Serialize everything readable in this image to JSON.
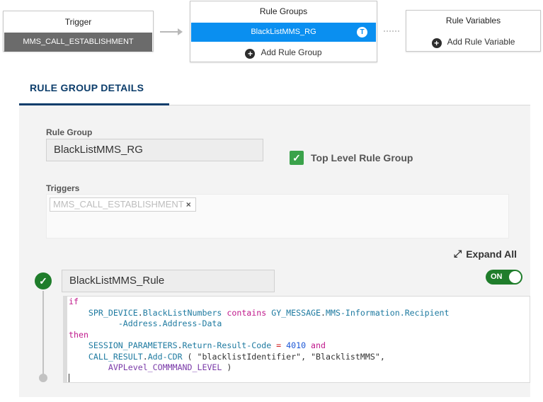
{
  "flow": {
    "trigger": {
      "title": "Trigger",
      "item": "MMS_CALL_ESTABLISHMENT"
    },
    "rule_groups": {
      "title": "Rule Groups",
      "selected": "BlackListMMS_RG",
      "badge": "T",
      "add_label": "Add Rule Group"
    },
    "rule_variables": {
      "title": "Rule Variables",
      "add_label": "Add Rule Variable"
    }
  },
  "section": {
    "tab_label": "RULE GROUP DETAILS"
  },
  "details": {
    "rule_group_label": "Rule Group",
    "rule_group_value": "BlackListMMS_RG",
    "top_level_label": "Top Level Rule Group",
    "top_level_checked": true,
    "triggers_label": "Triggers",
    "trigger_chip": "MMS_CALL_ESTABLISHMENT",
    "chip_remove": "×",
    "expand_all": "Expand All"
  },
  "rule": {
    "name": "BlackListMMS_Rule",
    "toggle_label": "ON",
    "code": {
      "l1_if": "if",
      "l2_obj": "SPR_DEVICE",
      "l2_dot": ".",
      "l2_field": "BlackListNumbers",
      "l2_kw": "contains",
      "l2_obj2": "GY_MESSAGE",
      "l2_dot2": ".",
      "l2_field2": "MMS-Information.Recipient",
      "l3_field": "-Address.Address-Data",
      "l4_then": "then",
      "l5_obj": "SESSION_PARAMETERS",
      "l5_dot": ".",
      "l5_field": "Return-Result-Code",
      "l5_op": "=",
      "l5_num": "4010",
      "l5_and": "and",
      "l6_obj": "CALL_RESULT",
      "l6_dot": ".",
      "l6_field": "Add-CDR",
      "l6_open": "(",
      "l6_str1": "\"blacklistIdentifier\"",
      "l6_comma": ",",
      "l6_str2": "\"BlacklistMMS\"",
      "l6_comma2": ",",
      "l7_field": "AVPLevel_COMMMAND_LEVEL",
      "l7_close": ")"
    }
  },
  "colors": {
    "selected_blue": "#0a8ff0",
    "section_navy": "#0c3d6b",
    "success_green": "#1f7d2b",
    "checkbox_green": "#3aa24a",
    "trigger_gray": "#6b6b6b"
  },
  "icons": {
    "add": "plus-circle-icon",
    "expand": "expand-arrows-icon",
    "valid": "check-circle-icon",
    "checkbox": "checkmark-icon"
  }
}
